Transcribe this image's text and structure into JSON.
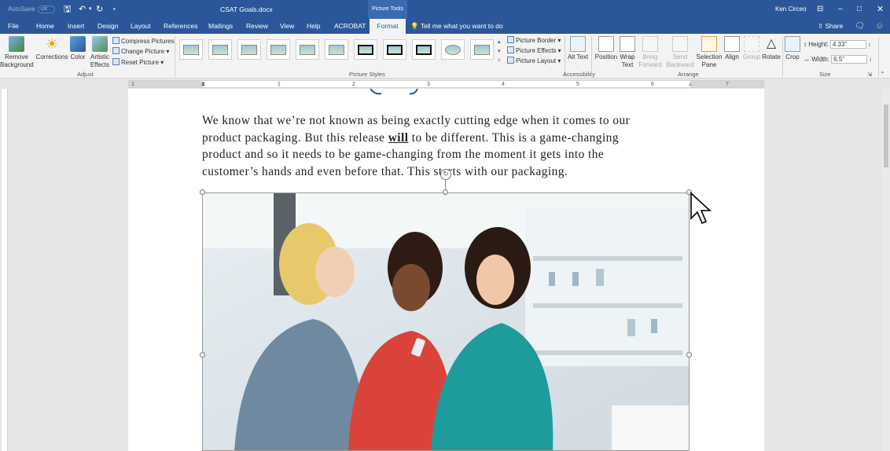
{
  "titlebar": {
    "autosave_label": "AutoSave",
    "autosave_state": "Off",
    "document_title": "CSAT Goals.docx",
    "context_group": "Picture Tools",
    "user_name": "Ken Circeo",
    "share_label": "Share"
  },
  "tabs": [
    "File",
    "Home",
    "Insert",
    "Design",
    "Layout",
    "References",
    "Mailings",
    "Review",
    "View",
    "Help",
    "ACROBAT",
    "Format"
  ],
  "active_tab": "Format",
  "tell_me": "Tell me what you want to do",
  "ribbon": {
    "adjust": {
      "remove_background": "Remove Background",
      "corrections": "Corrections",
      "color": "Color",
      "artistic_effects": "Artistic Effects",
      "compress": "Compress Pictures",
      "change": "Change Picture",
      "reset": "Reset Picture",
      "group_label": "Adjust"
    },
    "styles": {
      "border": "Picture Border",
      "effects": "Picture Effects",
      "layout": "Picture Layout",
      "group_label": "Picture Styles"
    },
    "accessibility": {
      "alt_text": "Alt Text",
      "group_label": "Accessibility"
    },
    "arrange": {
      "position": "Position",
      "wrap": "Wrap Text",
      "bring_forward": "Bring Forward",
      "send_backward": "Send Backward",
      "selection_pane": "Selection Pane",
      "align": "Align",
      "group": "Group",
      "rotate": "Rotate",
      "group_label": "Arrange"
    },
    "size": {
      "crop": "Crop",
      "height_label": "Height:",
      "height_value": "4.33\"",
      "width_label": "Width:",
      "width_value": "6.5\"",
      "group_label": "Size"
    }
  },
  "ruler_numbers": [
    "1",
    "1",
    "2",
    "3",
    "4",
    "5",
    "6",
    "7"
  ],
  "document": {
    "line1": "We know that we’re not known as being exactly cutting edge when it comes to our",
    "line2a": "product packaging. But this release ",
    "line2b": "will",
    "line2c": " to be different. This is a game-changing",
    "line3": "product and so it needs to be game-changing from the moment it gets into the",
    "line4": "customer’s hands and even before that. This starts with our packaging."
  },
  "colors": {
    "accent": "#2b579a",
    "ribbon": "#f3f3f3"
  }
}
